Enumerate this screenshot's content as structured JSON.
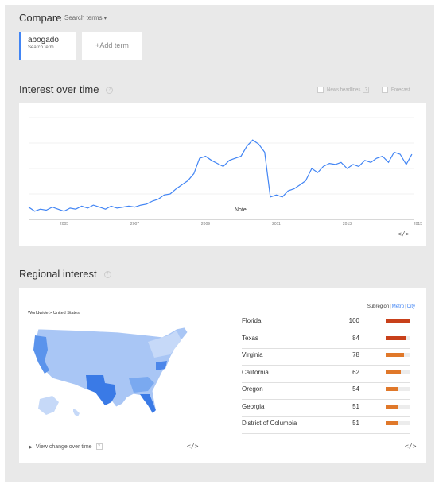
{
  "header": {
    "compare_label": "Compare",
    "search_terms_label": "Search terms"
  },
  "terms": [
    {
      "term": "abogado",
      "subtitle": "Search term",
      "color": "#4285f4"
    }
  ],
  "add_term_label": "+Add term",
  "interest_over_time": {
    "title": "Interest over time",
    "help": "?",
    "options": [
      {
        "label": "News headlines",
        "help": "?"
      },
      {
        "label": "Forecast",
        "help": "?"
      }
    ],
    "note_label": "Note",
    "embed_label": "</>"
  },
  "chart_data": {
    "type": "line",
    "series": [
      {
        "color": "#4285f4",
        "x": [
          2004.0,
          2004.17,
          2004.33,
          2004.5,
          2004.67,
          2004.83,
          2005.0,
          2005.17,
          2005.33,
          2005.5,
          2005.67,
          2005.83,
          2006.0,
          2006.17,
          2006.33,
          2006.5,
          2006.67,
          2006.83,
          2007.0,
          2007.17,
          2007.33,
          2007.5,
          2007.67,
          2007.83,
          2008.0,
          2008.17,
          2008.33,
          2008.5,
          2008.67,
          2008.83,
          2009.0,
          2009.17,
          2009.33,
          2009.5,
          2009.67,
          2009.83,
          2010.0,
          2010.17,
          2010.33,
          2010.5,
          2010.67,
          2010.83,
          2011.0,
          2011.17,
          2011.33,
          2011.5,
          2011.67,
          2011.83,
          2012.0,
          2012.17,
          2012.33,
          2012.5,
          2012.67,
          2012.83,
          2013.0,
          2013.17,
          2013.33,
          2013.5,
          2013.67,
          2013.83,
          2014.0,
          2014.17,
          2014.33,
          2014.5,
          2014.67,
          2014.83
        ],
        "y": [
          12,
          8,
          10,
          9,
          12,
          10,
          8,
          11,
          10,
          13,
          11,
          14,
          12,
          10,
          13,
          11,
          12,
          13,
          12,
          14,
          15,
          18,
          20,
          24,
          25,
          30,
          34,
          38,
          45,
          60,
          62,
          58,
          55,
          52,
          58,
          60,
          62,
          72,
          78,
          74,
          66,
          22,
          24,
          22,
          28,
          30,
          34,
          38,
          50,
          46,
          52,
          55,
          54,
          56,
          50,
          54,
          52,
          58,
          56,
          60,
          62,
          56,
          66,
          64,
          54,
          64
        ]
      }
    ],
    "x_ticks": [
      "2005",
      "2007",
      "2009",
      "2011",
      "2013",
      "2015"
    ],
    "ylim": [
      0,
      100
    ],
    "grid": true,
    "legend": "none"
  },
  "regional": {
    "title": "Regional interest",
    "help": "?",
    "breadcrumb": "Worldwide > United States",
    "toggle": {
      "subregion": "Subregion",
      "metro": "Metro",
      "city": "City"
    },
    "view_change_label": "View change over time",
    "view_change_help": "?",
    "embed_label": "</>",
    "rows": [
      {
        "name": "Florida",
        "value": 100,
        "color": "#c8401a"
      },
      {
        "name": "Texas",
        "value": 84,
        "color": "#c8401a"
      },
      {
        "name": "Virginia",
        "value": 78,
        "color": "#e0782a"
      },
      {
        "name": "California",
        "value": 62,
        "color": "#e0782a"
      },
      {
        "name": "Oregon",
        "value": 54,
        "color": "#e0782a"
      },
      {
        "name": "Georgia",
        "value": 51,
        "color": "#e0782a"
      },
      {
        "name": "District of Columbia",
        "value": 51,
        "color": "#e0782a"
      }
    ]
  }
}
